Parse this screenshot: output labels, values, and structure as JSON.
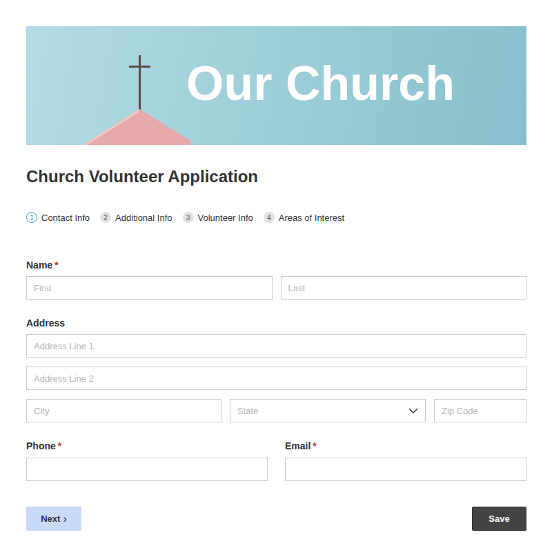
{
  "banner": {
    "title": "Our Church"
  },
  "form": {
    "title": "Church Volunteer Application"
  },
  "steps": [
    {
      "number": "1",
      "label": "Contact Info",
      "selected": true
    },
    {
      "number": "2",
      "label": "Additional Info",
      "selected": false
    },
    {
      "number": "3",
      "label": "Volunteer Info",
      "selected": false
    },
    {
      "number": "4",
      "label": "Areas of Interest",
      "selected": false
    }
  ],
  "required_mark": "*",
  "groups": [
    {
      "label": "Name",
      "required": true,
      "rows": [
        {
          "layout": "halves",
          "fields": [
            {
              "placeholder": "First",
              "kind": "text"
            },
            {
              "placeholder": "Last",
              "kind": "text"
            }
          ]
        }
      ]
    },
    {
      "label": "Address",
      "required": false,
      "rows": [
        {
          "layout": "full",
          "fields": [
            {
              "placeholder": "Address Line 1",
              "kind": "text"
            }
          ]
        },
        {
          "layout": "full",
          "fields": [
            {
              "placeholder": "Address Line 2",
              "kind": "text"
            }
          ]
        },
        {
          "layout": "thirds",
          "fields": [
            {
              "placeholder": "City",
              "kind": "text"
            },
            {
              "placeholder": "State",
              "kind": "select"
            },
            {
              "placeholder": "Zip Code",
              "kind": "text"
            }
          ]
        }
      ]
    }
  ],
  "contact_fields": [
    {
      "label": "Phone",
      "required": true,
      "placeholder": ""
    },
    {
      "label": "Email",
      "required": true,
      "placeholder": ""
    }
  ],
  "buttons": {
    "next": {
      "label": "Next",
      "icon": "›"
    },
    "save": {
      "label": "Save"
    }
  }
}
